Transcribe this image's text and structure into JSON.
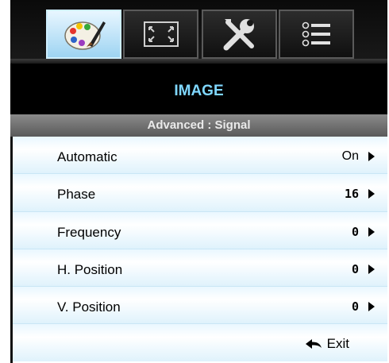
{
  "tabs": [
    {
      "id": "image",
      "icon": "palette-icon",
      "active": true
    },
    {
      "id": "display",
      "icon": "aspect-ratio-icon",
      "active": false
    },
    {
      "id": "setup",
      "icon": "tools-icon",
      "active": false
    },
    {
      "id": "options",
      "icon": "list-icon",
      "active": false
    }
  ],
  "header": {
    "title": "IMAGE"
  },
  "subheader": {
    "title": "Advanced : Signal"
  },
  "items": [
    {
      "label": "Automatic",
      "value": "On"
    },
    {
      "label": "Phase",
      "value": "16"
    },
    {
      "label": "Frequency",
      "value": "0"
    },
    {
      "label": "H. Position",
      "value": "0"
    },
    {
      "label": "V. Position",
      "value": "0"
    }
  ],
  "footer": {
    "exit_label": "Exit"
  },
  "colors": {
    "title": "#7fd7ff",
    "active_tab": "#9ed4f2",
    "row_tint": "#dff2fc"
  }
}
